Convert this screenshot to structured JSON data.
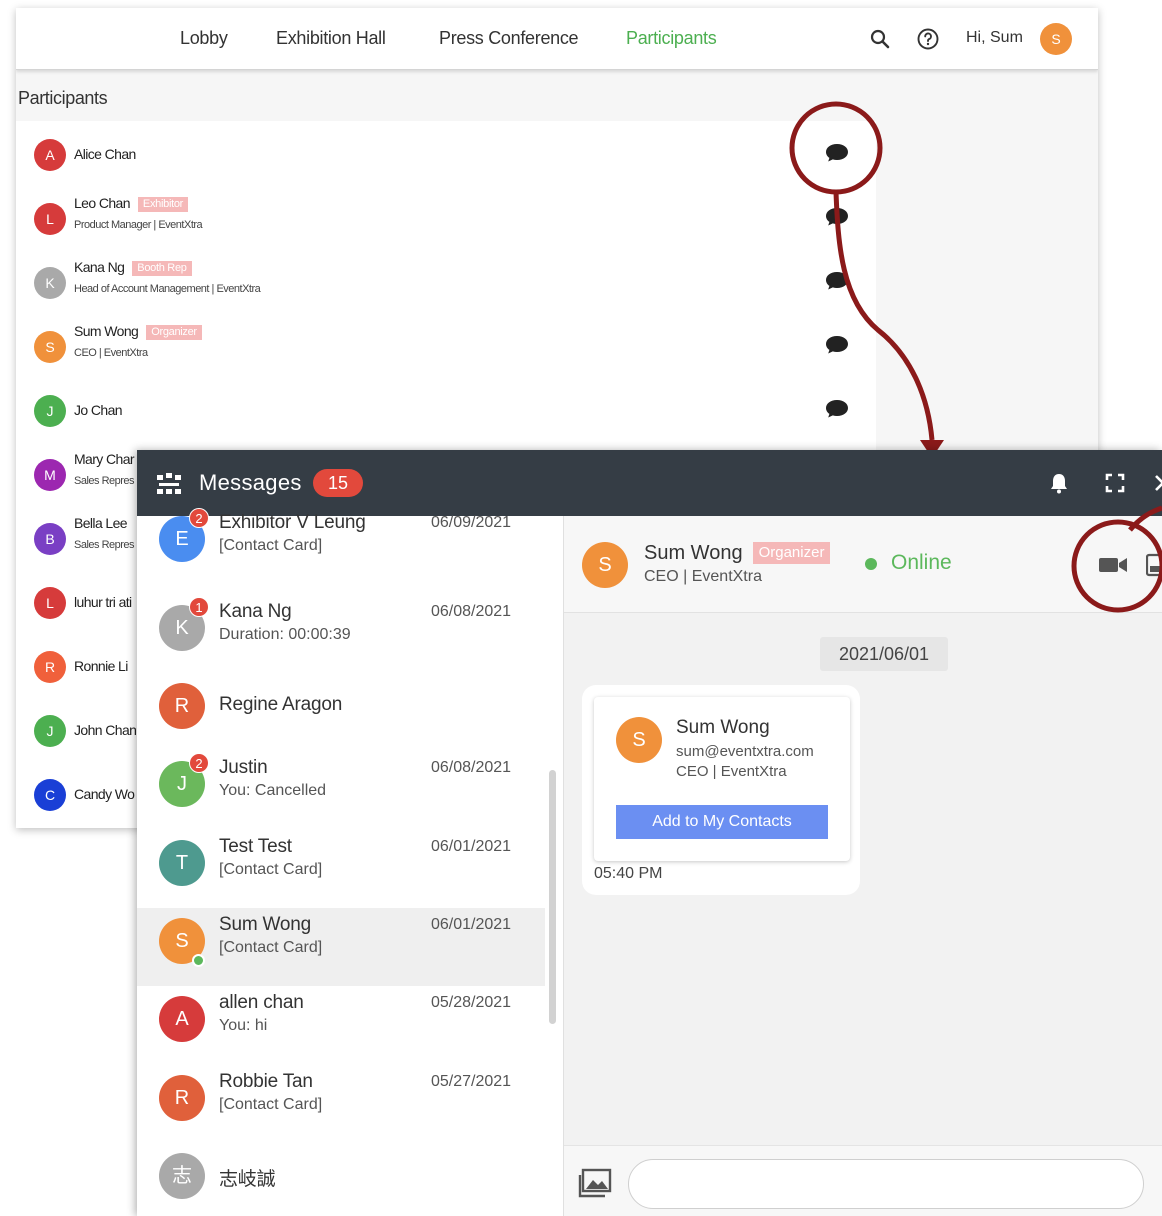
{
  "nav": {
    "links": [
      "Lobby",
      "Exhibition Hall",
      "Press Conference",
      "Participants"
    ],
    "active": "Participants",
    "greeting": "Hi, Sum",
    "avatar_initial": "S",
    "accent_color": "#4caf50"
  },
  "participants": {
    "title": "Participants",
    "items": [
      {
        "initial": "A",
        "name": "Alice Chan",
        "tag": "",
        "subtitle": "",
        "color": "#d63b3b"
      },
      {
        "initial": "L",
        "name": "Leo Chan",
        "tag": "Exhibitor",
        "subtitle": "Product Manager | EventXtra",
        "color": "#d63b3b"
      },
      {
        "initial": "K",
        "name": "Kana Ng",
        "tag": "Booth Rep",
        "subtitle": "Head of Account Management | EventXtra",
        "color": "#a9a9a9"
      },
      {
        "initial": "S",
        "name": "Sum Wong",
        "tag": "Organizer",
        "subtitle": "CEO | EventXtra",
        "color": "#f0913b"
      },
      {
        "initial": "J",
        "name": "Jo Chan",
        "tag": "",
        "subtitle": "",
        "color": "#4caf50"
      },
      {
        "initial": "M",
        "name": "Mary Char",
        "tag": "",
        "subtitle": "Sales Repres",
        "color": "#9c27b0"
      },
      {
        "initial": "B",
        "name": "Bella Lee",
        "tag": "",
        "subtitle": "Sales Repres",
        "color": "#7a3fc4"
      },
      {
        "initial": "L",
        "name": "luhur tri ati",
        "tag": "",
        "subtitle": "",
        "color": "#d63b3b"
      },
      {
        "initial": "R",
        "name": "Ronnie Li",
        "tag": "",
        "subtitle": "",
        "color": "#f0603b"
      },
      {
        "initial": "J",
        "name": "John Chan",
        "tag": "",
        "subtitle": "",
        "color": "#4caf50"
      },
      {
        "initial": "C",
        "name": "Candy Wo",
        "tag": "",
        "subtitle": "",
        "color": "#1a3fd6"
      }
    ]
  },
  "messages": {
    "title": "Messages",
    "unread": "15",
    "conversations": [
      {
        "initial": "E",
        "name": "Exhibitor V Leung",
        "preview": "[Contact Card]",
        "date": "06/09/2021",
        "badge": "2",
        "color": "#4a8df0"
      },
      {
        "initial": "K",
        "name": "Kana Ng",
        "preview": "Duration: 00:00:39",
        "date": "06/08/2021",
        "badge": "1",
        "color": "#a9a9a9"
      },
      {
        "initial": "R",
        "name": "Regine Aragon",
        "preview": "",
        "date": "",
        "badge": "",
        "color": "#e0603b"
      },
      {
        "initial": "J",
        "name": "Justin",
        "preview": "You: Cancelled",
        "date": "06/08/2021",
        "badge": "2",
        "color": "#6bb85c"
      },
      {
        "initial": "T",
        "name": "Test Test",
        "preview": "[Contact Card]",
        "date": "06/01/2021",
        "badge": "",
        "color": "#4e9a8f"
      },
      {
        "initial": "S",
        "name": "Sum Wong",
        "preview": "[Contact Card]",
        "date": "06/01/2021",
        "badge": "",
        "color": "#f0913b"
      },
      {
        "initial": "A",
        "name": "allen chan",
        "preview": "You: hi",
        "date": "05/28/2021",
        "badge": "",
        "color": "#d63b3b"
      },
      {
        "initial": "R",
        "name": "Robbie Tan",
        "preview": "[Contact Card]",
        "date": "05/27/2021",
        "badge": "",
        "color": "#e0603b"
      },
      {
        "initial": "志",
        "name": "志岐誠",
        "preview": "",
        "date": "",
        "badge": "",
        "color": "#a9a9a9"
      }
    ]
  },
  "chat": {
    "initial": "S",
    "name": "Sum Wong",
    "tag": "Organizer",
    "subtitle": "CEO | EventXtra",
    "status": "Online",
    "date_divider": "2021/06/01",
    "card": {
      "initial": "S",
      "name": "Sum Wong",
      "email": "sum@eventxtra.com",
      "subtitle": "CEO | EventXtra",
      "button": "Add to My Contacts"
    },
    "time": "05:40 PM",
    "input_placeholder": ""
  },
  "annotation_color": "#8b1a1a"
}
